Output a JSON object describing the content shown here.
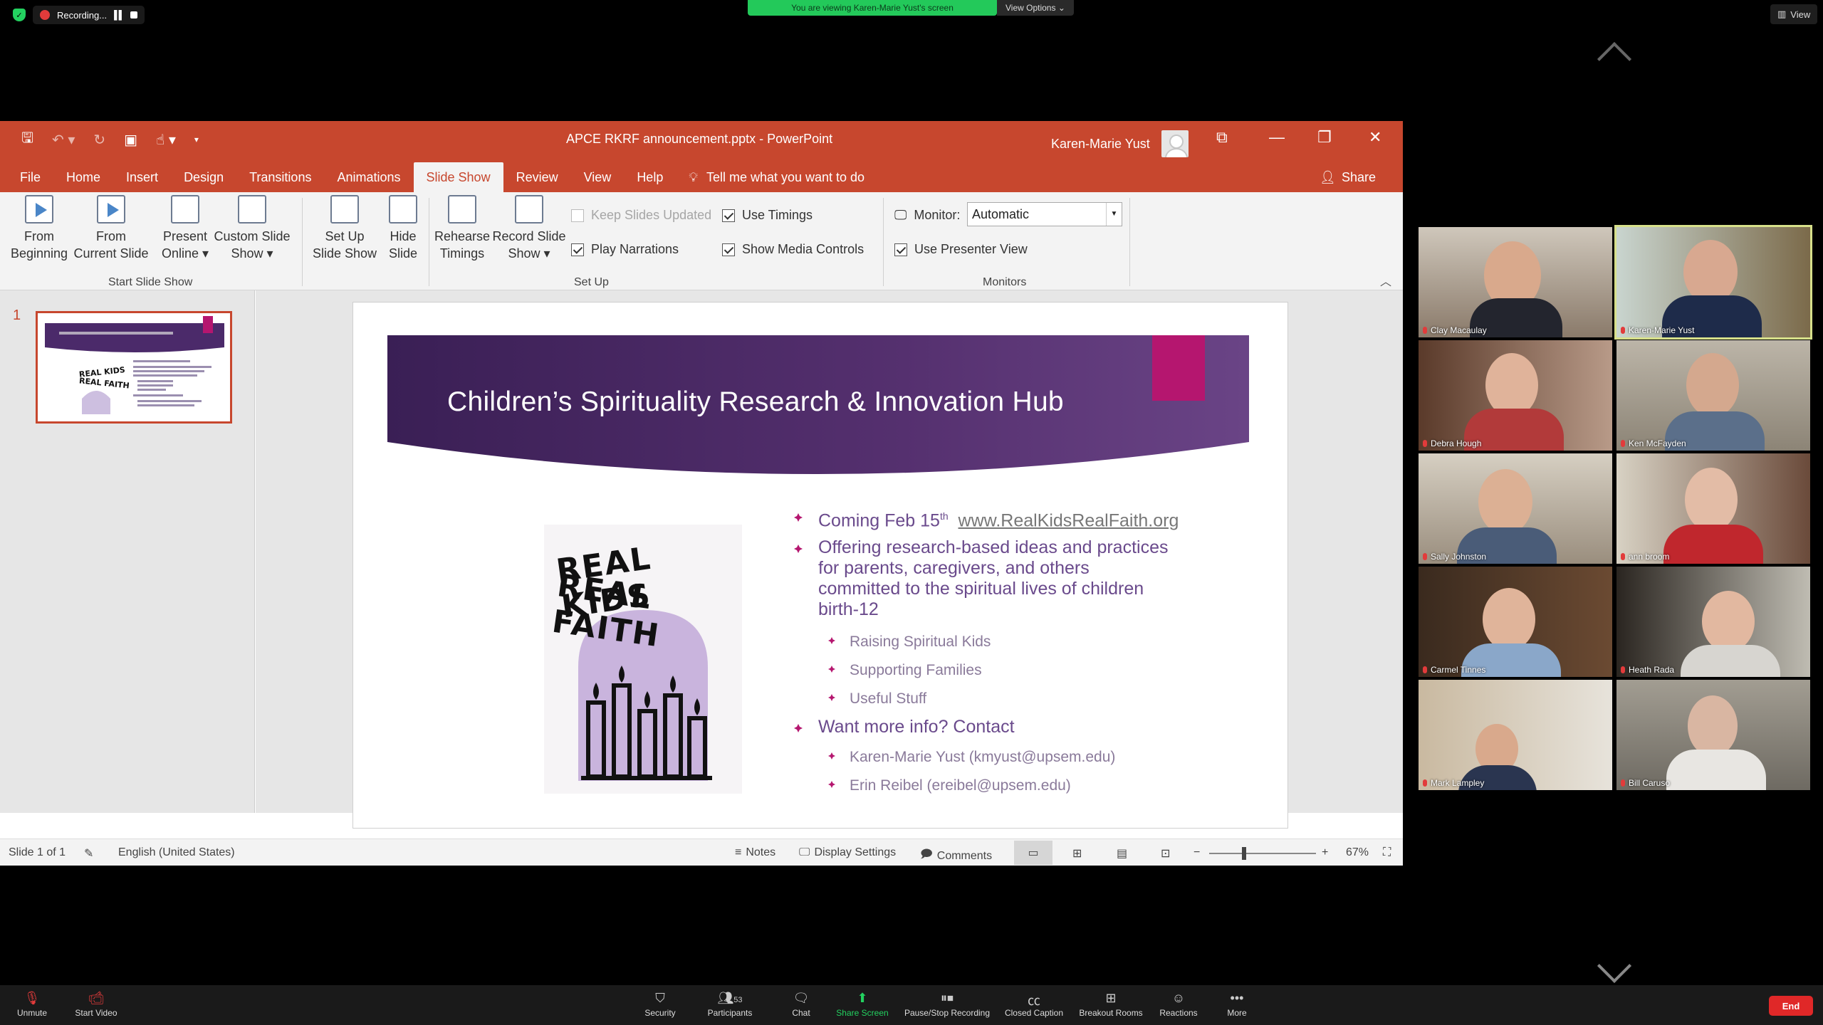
{
  "zoom": {
    "recording_label": "Recording...",
    "viewing_banner": "You are viewing Karen-Marie Yust's screen",
    "view_options": "View Options ⌄",
    "view_label": "View"
  },
  "ppt": {
    "doc_title": "APCE RKRF announcement.pptx  -  PowerPoint",
    "user": "Karen-Marie Yust",
    "tabs": [
      "File",
      "Home",
      "Insert",
      "Design",
      "Transitions",
      "Animations",
      "Slide Show",
      "Review",
      "View",
      "Help"
    ],
    "tell_me": "Tell me what you want to do",
    "share": "Share",
    "ribbon": {
      "from_beginning": [
        "From",
        "Beginning"
      ],
      "from_current": [
        "From",
        "Current Slide"
      ],
      "present_online": [
        "Present",
        "Online ▾"
      ],
      "custom_show": [
        "Custom Slide",
        "Show ▾"
      ],
      "group_start": "Start Slide Show",
      "setup_show": [
        "Set Up",
        "Slide Show"
      ],
      "hide_slide": [
        "Hide",
        "Slide"
      ],
      "rehearse": [
        "Rehearse",
        "Timings"
      ],
      "record": [
        "Record Slide",
        "Show ▾"
      ],
      "keep_updated": "Keep Slides Updated",
      "play_narrations": "Play Narrations",
      "use_timings": "Use Timings",
      "show_media": "Show Media Controls",
      "group_setup": "Set Up",
      "monitor_label": "Monitor:",
      "monitor_value": "Automatic",
      "presenter_view": "Use Presenter View",
      "group_monitors": "Monitors"
    },
    "thumb_number": "1",
    "slide": {
      "title": "Children’s Spirituality Research & Innovation Hub",
      "logo_line1": "REAL KIDS",
      "logo_line2": "REAL FAITH",
      "b1_text": "Coming Feb 15",
      "b1_sup": "th",
      "b1_link": "www.RealKidsRealFaith.org",
      "b2_lines": [
        "Offering research-based ideas and practices",
        "for parents, caregivers, and others",
        "committed to the spiritual lives of children",
        "birth-12"
      ],
      "sub1": [
        "Raising Spiritual Kids",
        "Supporting Families",
        "Useful Stuff"
      ],
      "b3": "Want more info? Contact",
      "sub2": [
        "Karen-Marie Yust (kmyust@upsem.edu)",
        "Erin Reibel (ereibel@upsem.edu)"
      ]
    },
    "status": {
      "slide_of": "Slide 1 of 1",
      "language": "English (United States)",
      "notes": "Notes",
      "display": "Display Settings",
      "comments": "Comments",
      "zoom": "67%"
    }
  },
  "participants": [
    {
      "name": "Clay Macaulay"
    },
    {
      "name": "Karen-Marie Yust"
    },
    {
      "name": "Debra Hough"
    },
    {
      "name": "Ken McFayden"
    },
    {
      "name": "Sally Johnston"
    },
    {
      "name": "ann broom"
    },
    {
      "name": "Carmel Tinnes"
    },
    {
      "name": "Heath Rada"
    },
    {
      "name": "Mark Lampley"
    },
    {
      "name": "Bill Caruso"
    }
  ],
  "bottom": {
    "unmute": "Unmute",
    "start_video": "Start Video",
    "security": "Security",
    "participants": "Participants",
    "participants_count": "53",
    "chat": "Chat",
    "share_screen": "Share Screen",
    "pause_rec": "Pause/Stop Recording",
    "cc": "Closed Caption",
    "breakout": "Breakout Rooms",
    "reactions": "Reactions",
    "more": "More",
    "end": "End"
  },
  "colors": {
    "ppt_accent": "#c7472e",
    "slide_purple": "#6a4a8c",
    "magenta": "#b5166f",
    "speaker_outline": "#d7e08a"
  }
}
